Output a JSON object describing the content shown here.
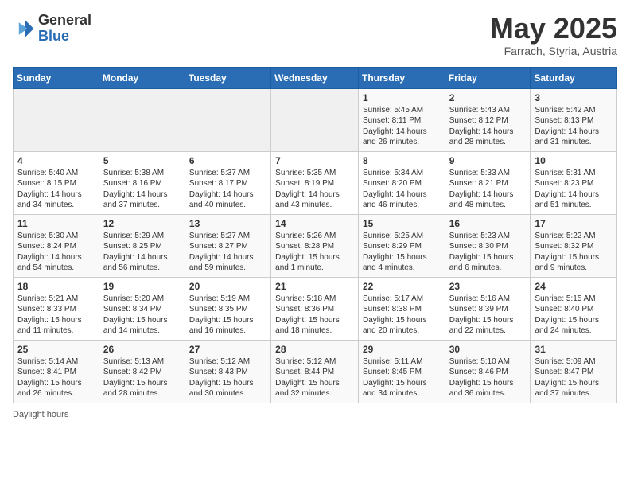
{
  "logo": {
    "general": "General",
    "blue": "Blue"
  },
  "title": {
    "month": "May 2025",
    "location": "Farrach, Styria, Austria"
  },
  "days_of_week": [
    "Sunday",
    "Monday",
    "Tuesday",
    "Wednesday",
    "Thursday",
    "Friday",
    "Saturday"
  ],
  "weeks": [
    [
      {
        "day": "",
        "info": ""
      },
      {
        "day": "",
        "info": ""
      },
      {
        "day": "",
        "info": ""
      },
      {
        "day": "",
        "info": ""
      },
      {
        "day": "1",
        "info": "Sunrise: 5:45 AM\nSunset: 8:11 PM\nDaylight: 14 hours and 26 minutes."
      },
      {
        "day": "2",
        "info": "Sunrise: 5:43 AM\nSunset: 8:12 PM\nDaylight: 14 hours and 28 minutes."
      },
      {
        "day": "3",
        "info": "Sunrise: 5:42 AM\nSunset: 8:13 PM\nDaylight: 14 hours and 31 minutes."
      }
    ],
    [
      {
        "day": "4",
        "info": "Sunrise: 5:40 AM\nSunset: 8:15 PM\nDaylight: 14 hours and 34 minutes."
      },
      {
        "day": "5",
        "info": "Sunrise: 5:38 AM\nSunset: 8:16 PM\nDaylight: 14 hours and 37 minutes."
      },
      {
        "day": "6",
        "info": "Sunrise: 5:37 AM\nSunset: 8:17 PM\nDaylight: 14 hours and 40 minutes."
      },
      {
        "day": "7",
        "info": "Sunrise: 5:35 AM\nSunset: 8:19 PM\nDaylight: 14 hours and 43 minutes."
      },
      {
        "day": "8",
        "info": "Sunrise: 5:34 AM\nSunset: 8:20 PM\nDaylight: 14 hours and 46 minutes."
      },
      {
        "day": "9",
        "info": "Sunrise: 5:33 AM\nSunset: 8:21 PM\nDaylight: 14 hours and 48 minutes."
      },
      {
        "day": "10",
        "info": "Sunrise: 5:31 AM\nSunset: 8:23 PM\nDaylight: 14 hours and 51 minutes."
      }
    ],
    [
      {
        "day": "11",
        "info": "Sunrise: 5:30 AM\nSunset: 8:24 PM\nDaylight: 14 hours and 54 minutes."
      },
      {
        "day": "12",
        "info": "Sunrise: 5:29 AM\nSunset: 8:25 PM\nDaylight: 14 hours and 56 minutes."
      },
      {
        "day": "13",
        "info": "Sunrise: 5:27 AM\nSunset: 8:27 PM\nDaylight: 14 hours and 59 minutes."
      },
      {
        "day": "14",
        "info": "Sunrise: 5:26 AM\nSunset: 8:28 PM\nDaylight: 15 hours and 1 minute."
      },
      {
        "day": "15",
        "info": "Sunrise: 5:25 AM\nSunset: 8:29 PM\nDaylight: 15 hours and 4 minutes."
      },
      {
        "day": "16",
        "info": "Sunrise: 5:23 AM\nSunset: 8:30 PM\nDaylight: 15 hours and 6 minutes."
      },
      {
        "day": "17",
        "info": "Sunrise: 5:22 AM\nSunset: 8:32 PM\nDaylight: 15 hours and 9 minutes."
      }
    ],
    [
      {
        "day": "18",
        "info": "Sunrise: 5:21 AM\nSunset: 8:33 PM\nDaylight: 15 hours and 11 minutes."
      },
      {
        "day": "19",
        "info": "Sunrise: 5:20 AM\nSunset: 8:34 PM\nDaylight: 15 hours and 14 minutes."
      },
      {
        "day": "20",
        "info": "Sunrise: 5:19 AM\nSunset: 8:35 PM\nDaylight: 15 hours and 16 minutes."
      },
      {
        "day": "21",
        "info": "Sunrise: 5:18 AM\nSunset: 8:36 PM\nDaylight: 15 hours and 18 minutes."
      },
      {
        "day": "22",
        "info": "Sunrise: 5:17 AM\nSunset: 8:38 PM\nDaylight: 15 hours and 20 minutes."
      },
      {
        "day": "23",
        "info": "Sunrise: 5:16 AM\nSunset: 8:39 PM\nDaylight: 15 hours and 22 minutes."
      },
      {
        "day": "24",
        "info": "Sunrise: 5:15 AM\nSunset: 8:40 PM\nDaylight: 15 hours and 24 minutes."
      }
    ],
    [
      {
        "day": "25",
        "info": "Sunrise: 5:14 AM\nSunset: 8:41 PM\nDaylight: 15 hours and 26 minutes."
      },
      {
        "day": "26",
        "info": "Sunrise: 5:13 AM\nSunset: 8:42 PM\nDaylight: 15 hours and 28 minutes."
      },
      {
        "day": "27",
        "info": "Sunrise: 5:12 AM\nSunset: 8:43 PM\nDaylight: 15 hours and 30 minutes."
      },
      {
        "day": "28",
        "info": "Sunrise: 5:12 AM\nSunset: 8:44 PM\nDaylight: 15 hours and 32 minutes."
      },
      {
        "day": "29",
        "info": "Sunrise: 5:11 AM\nSunset: 8:45 PM\nDaylight: 15 hours and 34 minutes."
      },
      {
        "day": "30",
        "info": "Sunrise: 5:10 AM\nSunset: 8:46 PM\nDaylight: 15 hours and 36 minutes."
      },
      {
        "day": "31",
        "info": "Sunrise: 5:09 AM\nSunset: 8:47 PM\nDaylight: 15 hours and 37 minutes."
      }
    ]
  ],
  "footer": {
    "note": "Daylight hours"
  }
}
